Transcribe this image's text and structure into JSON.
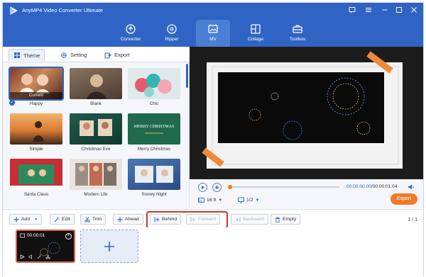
{
  "app": {
    "title": "AnyMP4 Video Converter Ultimate"
  },
  "nav": {
    "items": [
      {
        "label": "Converter",
        "icon": "converter-icon"
      },
      {
        "label": "Ripper",
        "icon": "ripper-icon"
      },
      {
        "label": "MV",
        "icon": "mv-icon",
        "active": true
      },
      {
        "label": "Collage",
        "icon": "collage-icon"
      },
      {
        "label": "Toolbox",
        "icon": "toolbox-icon"
      }
    ]
  },
  "left_tabs": {
    "theme": "Theme",
    "setting": "Setting",
    "export": "Export"
  },
  "themes": [
    {
      "name": "Happy",
      "badge": "Current"
    },
    {
      "name": "Blank"
    },
    {
      "name": "Chic"
    },
    {
      "name": "Simple"
    },
    {
      "name": "Christmas Eve"
    },
    {
      "name": "Merry Christmas",
      "caption": "MERRY CHRISTMAS"
    },
    {
      "name": "Santa Claus"
    },
    {
      "name": "Modern Life"
    },
    {
      "name": "Snowy Night"
    }
  ],
  "player": {
    "current_time": "00:00:00.00",
    "total_time": "00:00:01.04",
    "separator": "/",
    "ratio": "16:9",
    "page": "1/2",
    "export_label": "Export"
  },
  "toolbar": {
    "add": "Add",
    "edit": "Edit",
    "trim": "Trim",
    "ahead": "Ahead",
    "behind": "Behind",
    "forward": "Forward",
    "backward": "Backward",
    "empty": "Empty",
    "pager_current": "1",
    "pager_sep": "/",
    "pager_total": "1"
  },
  "clip": {
    "duration": "00:00:01"
  },
  "colors": {
    "accent": "#2f64c4",
    "export": "#f07a2a",
    "highlight": "#c0392b"
  }
}
